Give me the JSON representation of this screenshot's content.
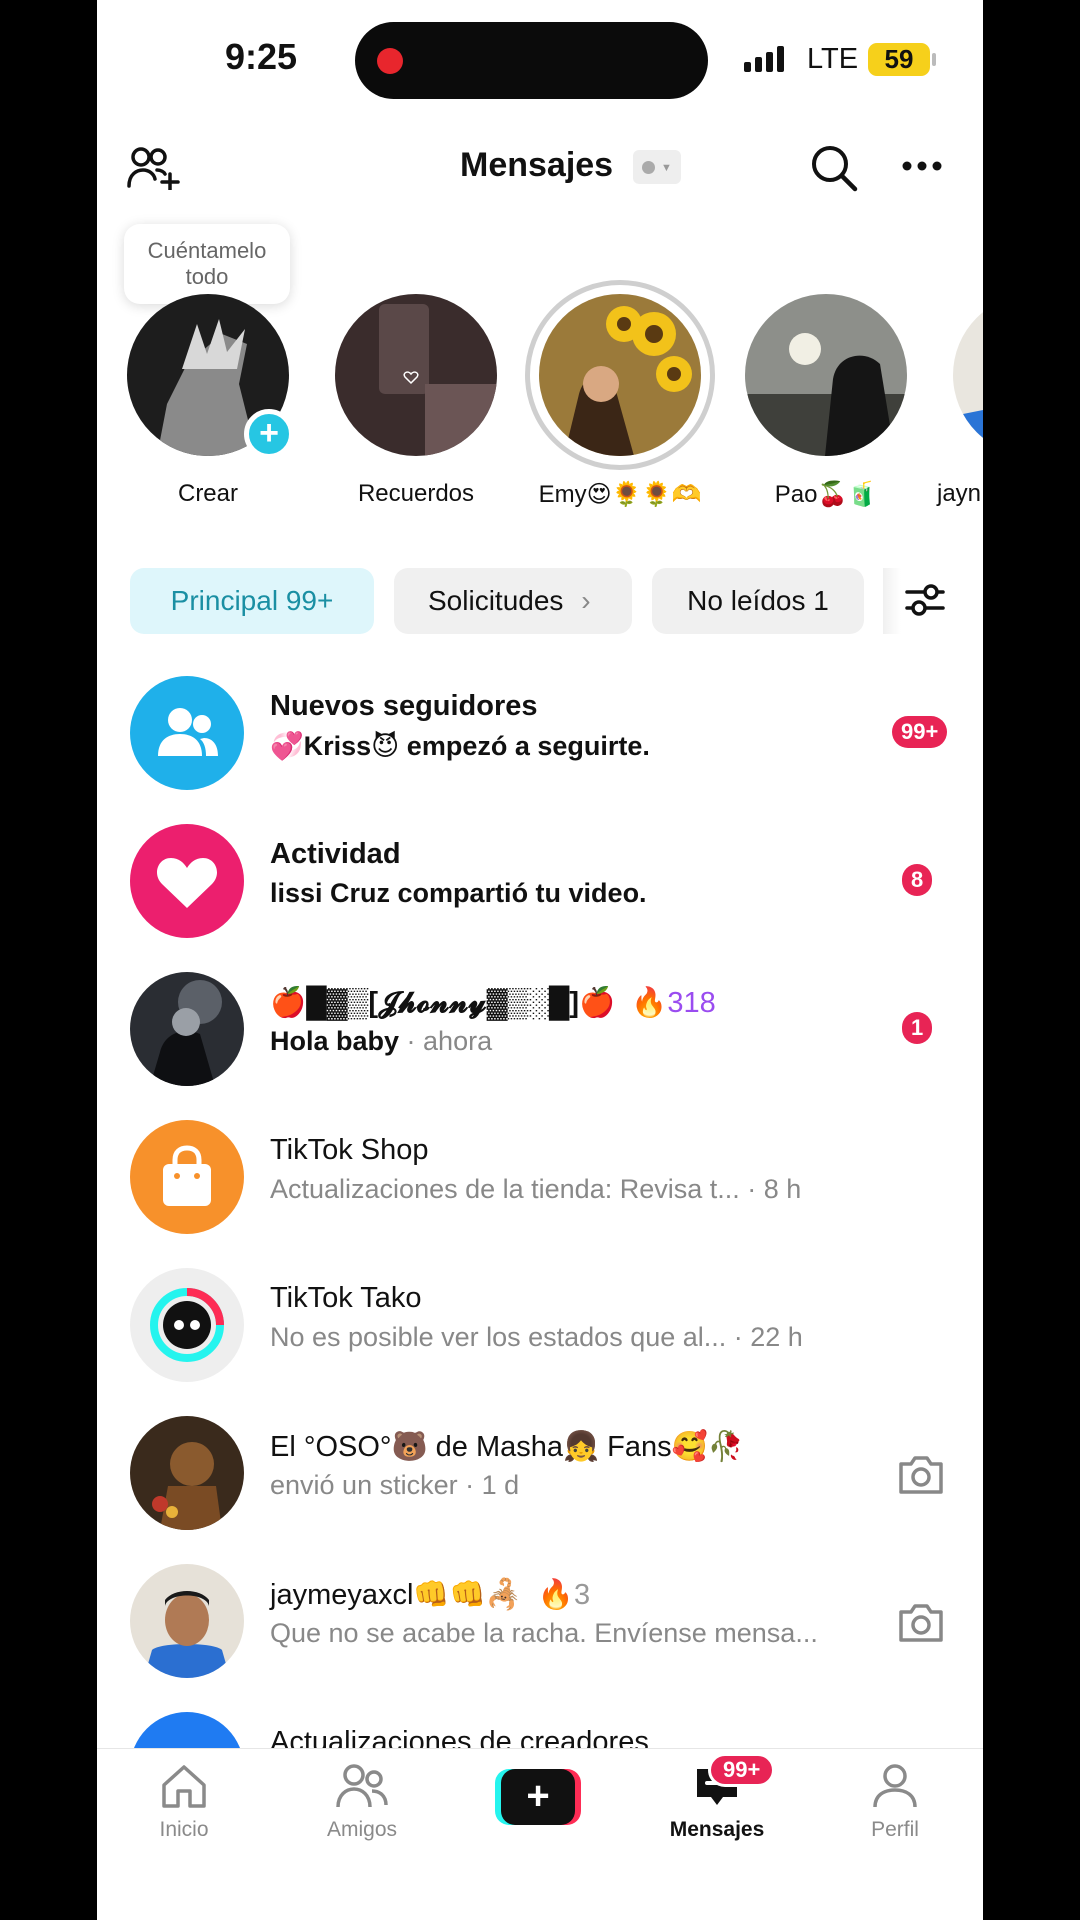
{
  "status_bar": {
    "time": "9:25",
    "network": "LTE",
    "battery": "59"
  },
  "header": {
    "title": "Mensajes"
  },
  "stories": {
    "bubble_text": "Cuéntamelo todo",
    "items": [
      {
        "label": "Crear"
      },
      {
        "label": "Recuerdos"
      },
      {
        "label": "Emy😍🌻🌻🫶"
      },
      {
        "label": "Pao🍒🧃"
      },
      {
        "label": "jayn"
      }
    ]
  },
  "tabs": {
    "principal": "Principal 99+",
    "solicitudes": "Solicitudes",
    "no_leidos": "No leídos 1"
  },
  "conversations": [
    {
      "title": "Nuevos seguidores",
      "subtitle": "💞Kriss😈 empezó a seguirte.",
      "badge": "99+",
      "icon": "followers-icon"
    },
    {
      "title": "Actividad",
      "subtitle": "lissi Cruz compartió tu video.",
      "badge": "8",
      "icon": "heart-icon"
    },
    {
      "title": "🍎█▓▒[𝓙𝓱𝓸𝓷𝓷𝔂▓▒░█]🍎",
      "streak": "318",
      "subtitle": "Hola baby",
      "time": "· ahora",
      "badge": "1"
    },
    {
      "title": "TikTok Shop",
      "subtitle": "Actualizaciones de la tienda: Revisa t...",
      "time": "· 8 h",
      "icon": "shopping-bag-icon"
    },
    {
      "title": "TikTok Tako",
      "subtitle": "No es posible ver los estados que al...",
      "time": "· 22 h",
      "icon": "tako-icon"
    },
    {
      "title": "El °OSO°🐻 de Masha👧 Fans🥰🥀",
      "subtitle": "envió un sticker · 1 d"
    },
    {
      "title": "jaymeyaxcl👊👊🦂",
      "streak": "3",
      "subtitle": "Que no se acabe la racha. Envíense mensa..."
    },
    {
      "title": "Actualizaciones de creadores"
    }
  ],
  "nav": {
    "inicio": "Inicio",
    "amigos": "Amigos",
    "mensajes": "Mensajes",
    "perfil": "Perfil",
    "mensajes_badge": "99+"
  },
  "colors": {
    "accent": "#1a8fa3",
    "badge": "#e82455",
    "activity": "#ec1f6e",
    "followers": "#1fb0ea",
    "shop": "#f7912b",
    "streak": "#9a4cf0"
  }
}
